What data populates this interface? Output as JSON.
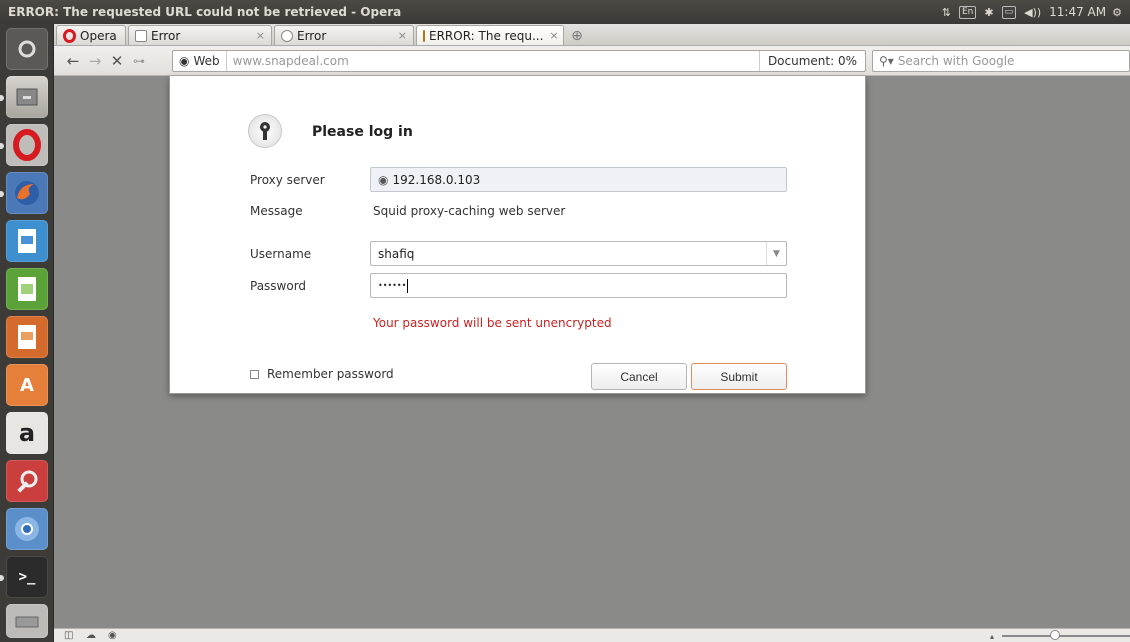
{
  "window": {
    "title": "ERROR: The requested URL could not be retrieved - Opera",
    "keyboard_layout": "En",
    "clock": "11:47 AM"
  },
  "tabs": [
    {
      "label": "Opera"
    },
    {
      "label": "Error"
    },
    {
      "label": "Error"
    },
    {
      "label": "ERROR: The requ..."
    }
  ],
  "address_bar": {
    "badge": "Web",
    "url": "www.snapdeal.com",
    "progress": "Document: 0%"
  },
  "search_bar": {
    "placeholder": "Search with Google"
  },
  "dialog": {
    "title": "Please log in",
    "proxy_label": "Proxy server",
    "proxy_value": "192.168.0.103",
    "message_label": "Message",
    "message_value": "Squid proxy-caching web server",
    "username_label": "Username",
    "username_value": "shafiq",
    "password_label": "Password",
    "password_value": "••••••",
    "warning": "Your password will be sent unencrypted",
    "remember_label": "Remember password",
    "cancel_label": "Cancel",
    "submit_label": "Submit"
  },
  "colors": {
    "warning": "#cc2020",
    "submit_border": "#e58a5b",
    "launcher_bg": "#3c3b37"
  }
}
